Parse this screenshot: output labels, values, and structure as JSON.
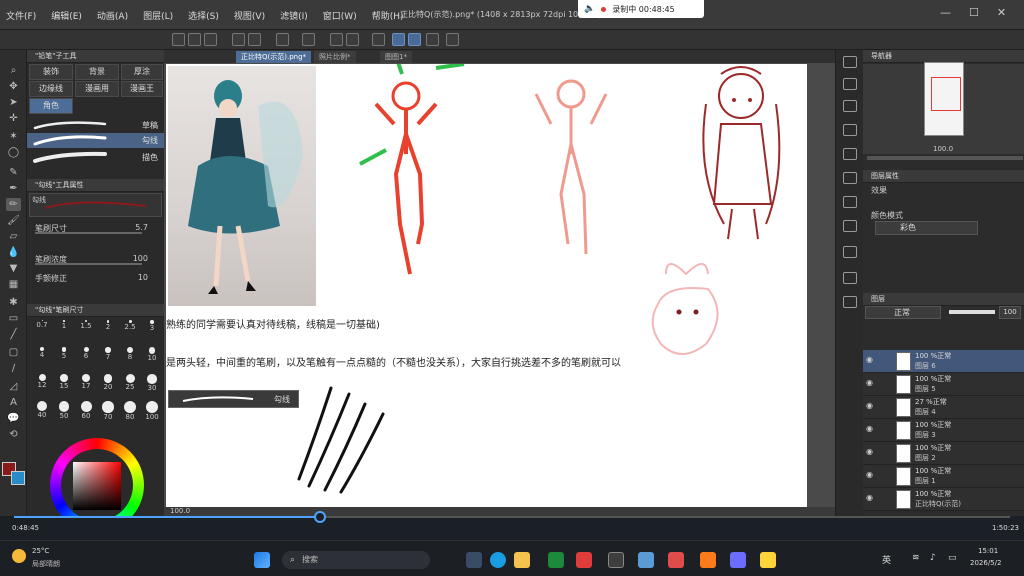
{
  "menubar": {
    "items": [
      "文件(F)",
      "编辑(E)",
      "动画(A)",
      "图层(L)",
      "选择(S)",
      "视图(V)",
      "滤镜(I)",
      "窗口(W)",
      "帮助(H)"
    ],
    "title": "正比特Q(示范).png* (1408 x 2813px 72dpi 100.0%)"
  },
  "recording": {
    "label": "录制中 00:48:45"
  },
  "tabs": [
    "正比特Q(示范).png*",
    "照片比例*",
    "图图1*"
  ],
  "subtool": {
    "header": "\"铅笔\"子工具",
    "buttons": [
      "装饰",
      "背景",
      "厚涂",
      "边缘线",
      "漫画用",
      "漫画王",
      "角色"
    ],
    "brushes": [
      "草稿",
      "勾线",
      "描色"
    ],
    "props_header": "\"勾线\"工具属性",
    "props_name": "勾线",
    "props": [
      {
        "label": "笔刷尺寸",
        "value": "5.7"
      },
      {
        "label": "笔刷浓度",
        "value": "100"
      },
      {
        "label": "手颤修正",
        "value": "10"
      }
    ],
    "size_header": "\"勾线\"笔刷尺寸",
    "sizes": [
      "0.7",
      "1",
      "1.5",
      "2",
      "2.5",
      "3",
      "4",
      "5",
      "6",
      "7",
      "8",
      "10",
      "12",
      "15",
      "17",
      "20",
      "25",
      "30",
      "40",
      "50",
      "60",
      "70",
      "80",
      "100"
    ]
  },
  "canvas": {
    "note1": "熟练的同学需要认真对待线稿，线稿是一切基础)",
    "note2": "是两头轻，中间重的笔刷，以及笔触有一点点糙的（不糙也没关系），大家自行挑选差不多的笔刷就可以",
    "brush_sample_label": "勾线",
    "status_zoom": "100.0"
  },
  "navigator": {
    "title": "导航器",
    "zoom": "100.0"
  },
  "layer_props": {
    "title": "图层属性",
    "effect": "效果",
    "color_mode_label": "颜色模式",
    "color_mode_value": "彩色"
  },
  "layers_panel": {
    "title": "图层",
    "blend": "正常",
    "opacity": "100",
    "layers": [
      {
        "line1": "100 %正常",
        "line2": "图层 6",
        "selected": true
      },
      {
        "line1": "100 %正常",
        "line2": "图层 5",
        "selected": false
      },
      {
        "line1": "27 %正常",
        "line2": "图层 4",
        "selected": false
      },
      {
        "line1": "100 %正常",
        "line2": "图层 3",
        "selected": false
      },
      {
        "line1": "100 %正常",
        "line2": "图层 2",
        "selected": false
      },
      {
        "line1": "100 %正常",
        "line2": "图层 1",
        "selected": false
      },
      {
        "line1": "100 %正常",
        "line2": "正比特Q(示范)",
        "selected": false
      }
    ]
  },
  "player": {
    "current": "0:48:45",
    "duration": "1:50:23",
    "progress": 0.307
  },
  "taskbar": {
    "weather_temp": "25°C",
    "weather_desc": "局部晴朗",
    "search": "搜索",
    "ime": "英",
    "time": "15:01",
    "date": "2026/5/2"
  },
  "colors": {
    "main": "#8b1a1a",
    "sub": "#2a8bc9",
    "accent": "#4d6c96"
  }
}
